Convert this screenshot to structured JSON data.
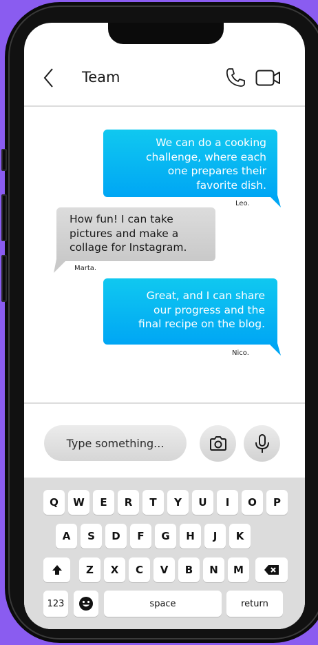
{
  "header": {
    "title": "Team"
  },
  "messages": [
    {
      "direction": "out",
      "text_lines": [
        "We can do a cooking",
        "challenge, where each",
        "one prepares their",
        "favorite dish."
      ],
      "sender": "Leo."
    },
    {
      "direction": "in",
      "text_lines": [
        "How fun! I can take",
        "pictures and make a",
        "collage for Instagram."
      ],
      "sender": "Marta."
    },
    {
      "direction": "out",
      "text_lines": [
        "Great, and I can share",
        "our progress and the",
        "final recipe on the blog."
      ],
      "sender": "Nico."
    }
  ],
  "composer": {
    "placeholder": "Type something..."
  },
  "keyboard": {
    "row1": [
      "Q",
      "W",
      "E",
      "R",
      "T",
      "Y",
      "U",
      "I",
      "O",
      "P"
    ],
    "row2": [
      "A",
      "S",
      "D",
      "F",
      "G",
      "H",
      "J",
      "K"
    ],
    "row3": [
      "Z",
      "X",
      "C",
      "V",
      "B",
      "N",
      "M"
    ],
    "numbers_label": "123",
    "space_label": "space",
    "return_label": "return"
  },
  "colors": {
    "background": "#8a5cf0",
    "outgoing_bubble": "#00b4f4",
    "incoming_bubble": "#d4d4d4"
  },
  "icons": {
    "back": "chevron-left-icon",
    "call": "phone-icon",
    "video": "video-camera-icon",
    "camera": "camera-icon",
    "mic": "microphone-icon",
    "shift": "shift-arrow-icon",
    "delete": "backspace-icon",
    "emoji": "emoji-icon"
  }
}
